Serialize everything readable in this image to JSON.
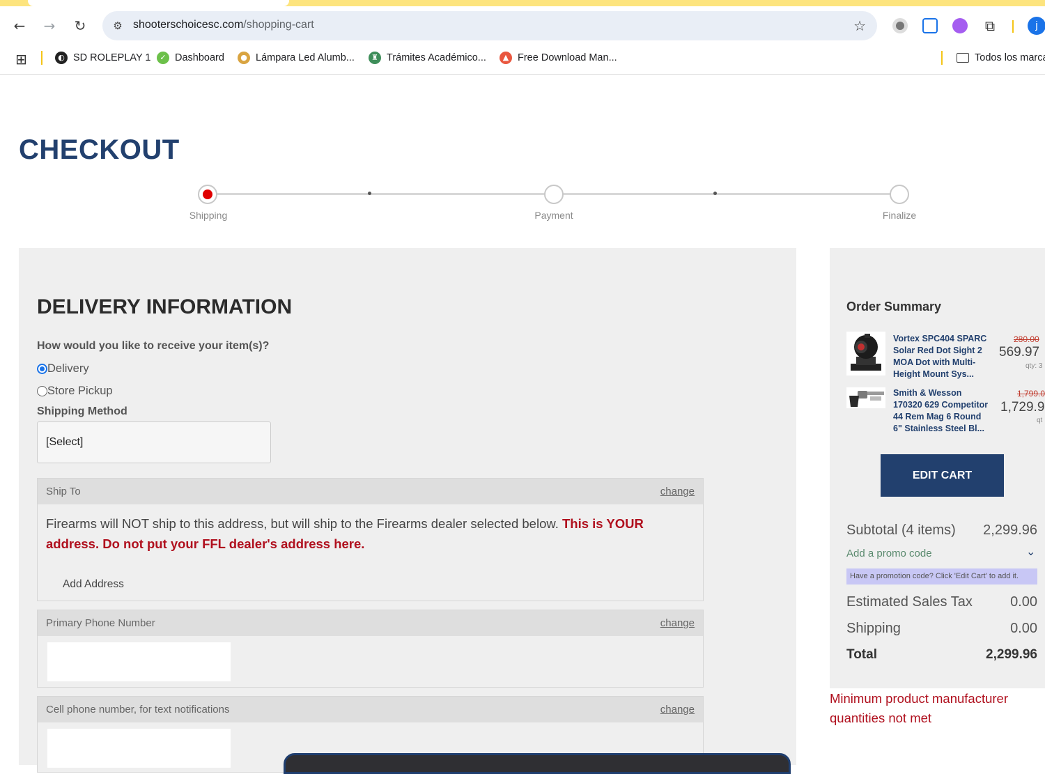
{
  "browser": {
    "url_domain": "shooterschoicesc.com",
    "url_path": "/shopping-cart",
    "profile_initial": "j",
    "bookmarks": [
      {
        "label": "SD ROLEPLAY 1",
        "icon": "globe-icon"
      },
      {
        "label": "Dashboard",
        "icon": "dashboard-icon"
      },
      {
        "label": "Lámpara Led Alumb...",
        "icon": "lamp-icon"
      },
      {
        "label": "Trámites Académico...",
        "icon": "academic-icon"
      },
      {
        "label": "Free Download Man...",
        "icon": "download-icon"
      }
    ],
    "all_bookmarks_label": "Todos los marca"
  },
  "page": {
    "title": "CHECKOUT",
    "steps": [
      "Shipping",
      "Payment",
      "Finalize"
    ],
    "active_step": "Shipping"
  },
  "delivery": {
    "heading": "DELIVERY INFORMATION",
    "question": "How would you like to receive your item(s)?",
    "options": [
      "Delivery",
      "Store Pickup"
    ],
    "selected_option": "Delivery",
    "shipping_method_label": "Shipping Method",
    "shipping_method_value": "[Select]",
    "ship_to": {
      "label": "Ship To",
      "change": "change",
      "notice": "Firearms will NOT ship to this address, but will ship to the Firearms dealer selected below.",
      "notice_warning": "This is YOUR address. Do not put your FFL dealer's address here.",
      "add_address": "Add Address"
    },
    "primary_phone": {
      "label": "Primary Phone Number",
      "change": "change",
      "value": ""
    },
    "cell_phone": {
      "label": "Cell phone number, for text notifications",
      "change": "change",
      "value": ""
    }
  },
  "summary": {
    "title": "Order Summary",
    "items": [
      {
        "name": "Vortex SPC404 SPARC Solar Red Dot Sight 2 MOA Dot with Multi-Height Mount Sys...",
        "old_price": "280.00",
        "price": "569.97",
        "qty": "qty: 3"
      },
      {
        "name": "Smith & Wesson 170320 629 Competitor 44 Rem Mag 6 Round 6\" Stainless Steel Bl...",
        "old_price": "1,799.0",
        "price": "1,729.9",
        "qty": "qt"
      }
    ],
    "edit_cart": "EDIT CART",
    "subtotal_label": "Subtotal (4 items)",
    "subtotal_value": "2,299.96",
    "promo_link": "Add a promo code",
    "promo_note": "Have a promotion code? Click 'Edit Cart' to add it.",
    "tax_label": "Estimated Sales Tax",
    "tax_value": "0.00",
    "shipping_label": "Shipping",
    "shipping_value": "0.00",
    "total_label": "Total",
    "total_value": "2,299.96",
    "warning": "Minimum product manufacturer quantities not met"
  }
}
